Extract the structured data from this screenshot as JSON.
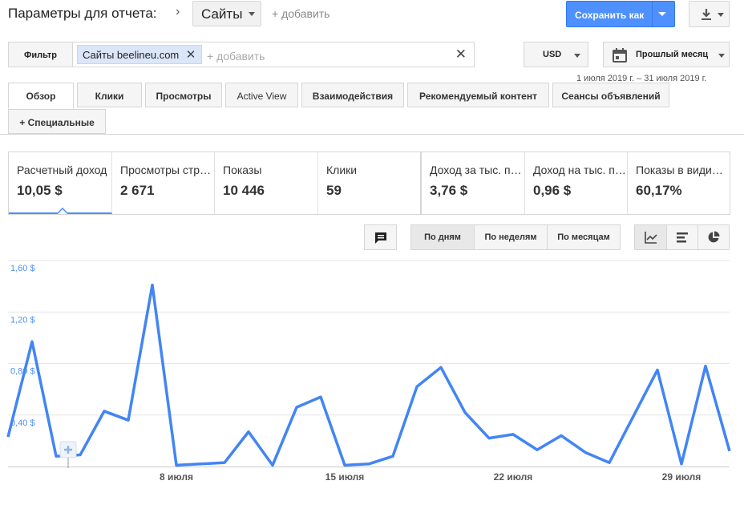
{
  "header": {
    "params_label": "Параметры для отчета:",
    "sites_dropdown": "Сайты",
    "add_label": "+ добавить",
    "save_as": "Сохранить как"
  },
  "filter": {
    "button": "Фильтр",
    "chip": "Сайты beelineu.com",
    "add_placeholder": "+ добавить",
    "currency": "USD",
    "period": "Прошлый месяц",
    "date_range": "1 июля 2019 г. – 31 июля 2019 г."
  },
  "tabs": [
    {
      "label": "Обзор"
    },
    {
      "label": "Клики"
    },
    {
      "label": "Просмотры"
    },
    {
      "label": "Active View"
    },
    {
      "label": "Взаимодействия"
    },
    {
      "label": "Рекомендуемый контент"
    },
    {
      "label": "Сеансы объявлений"
    },
    {
      "label": "+  Специальные"
    }
  ],
  "metrics": [
    {
      "name": "Расчетный доход",
      "value": "10,05 $"
    },
    {
      "name": "Просмотры страниц",
      "value": "2 671"
    },
    {
      "name": "Показы",
      "value": "10 446"
    },
    {
      "name": "Клики",
      "value": "59"
    },
    {
      "name": "Доход за тыс. показов",
      "value": "3,76 $"
    },
    {
      "name": "Доход на тыс. просмотров",
      "value": "0,96 $"
    },
    {
      "name": "Показы в видимой области",
      "value": "60,17%"
    }
  ],
  "toolbar": {
    "by_days": "По дням",
    "by_weeks": "По неделям",
    "by_months": "По месяцам"
  },
  "colors": {
    "accent": "#4d90fe",
    "line": "#4285f4"
  },
  "icons": [
    "chevron-right-icon",
    "download-icon",
    "calendar-icon",
    "comment-icon",
    "line-chart-icon",
    "bar-chart-icon",
    "pie-chart-icon",
    "plus-icon"
  ],
  "chart_data": {
    "type": "line",
    "x": [
      1,
      2,
      3,
      4,
      5,
      6,
      7,
      8,
      9,
      10,
      11,
      12,
      13,
      14,
      15,
      16,
      17,
      18,
      19,
      20,
      21,
      22,
      23,
      24,
      25,
      26,
      27,
      28,
      29,
      30,
      31
    ],
    "values": [
      0.23,
      0.97,
      0.08,
      0.09,
      0.43,
      0.36,
      1.41,
      0.01,
      0.02,
      0.03,
      0.27,
      0.01,
      0.46,
      0.54,
      0.01,
      0.02,
      0.08,
      0.62,
      0.77,
      0.42,
      0.22,
      0.25,
      0.13,
      0.24,
      0.11,
      0.03,
      0.39,
      0.75,
      0.02,
      0.78,
      0.12
    ],
    "yticks": [
      "0,40 $",
      "0,80 $",
      "1,20 $",
      "1,60 $"
    ],
    "ytick_values": [
      0.4,
      0.8,
      1.2,
      1.6
    ],
    "ylim": [
      0,
      1.6
    ],
    "xticks": [
      "8 июля",
      "15 июля",
      "22 июля",
      "29 июля"
    ],
    "xtick_days": [
      8,
      15,
      22,
      29
    ],
    "grid": true
  }
}
